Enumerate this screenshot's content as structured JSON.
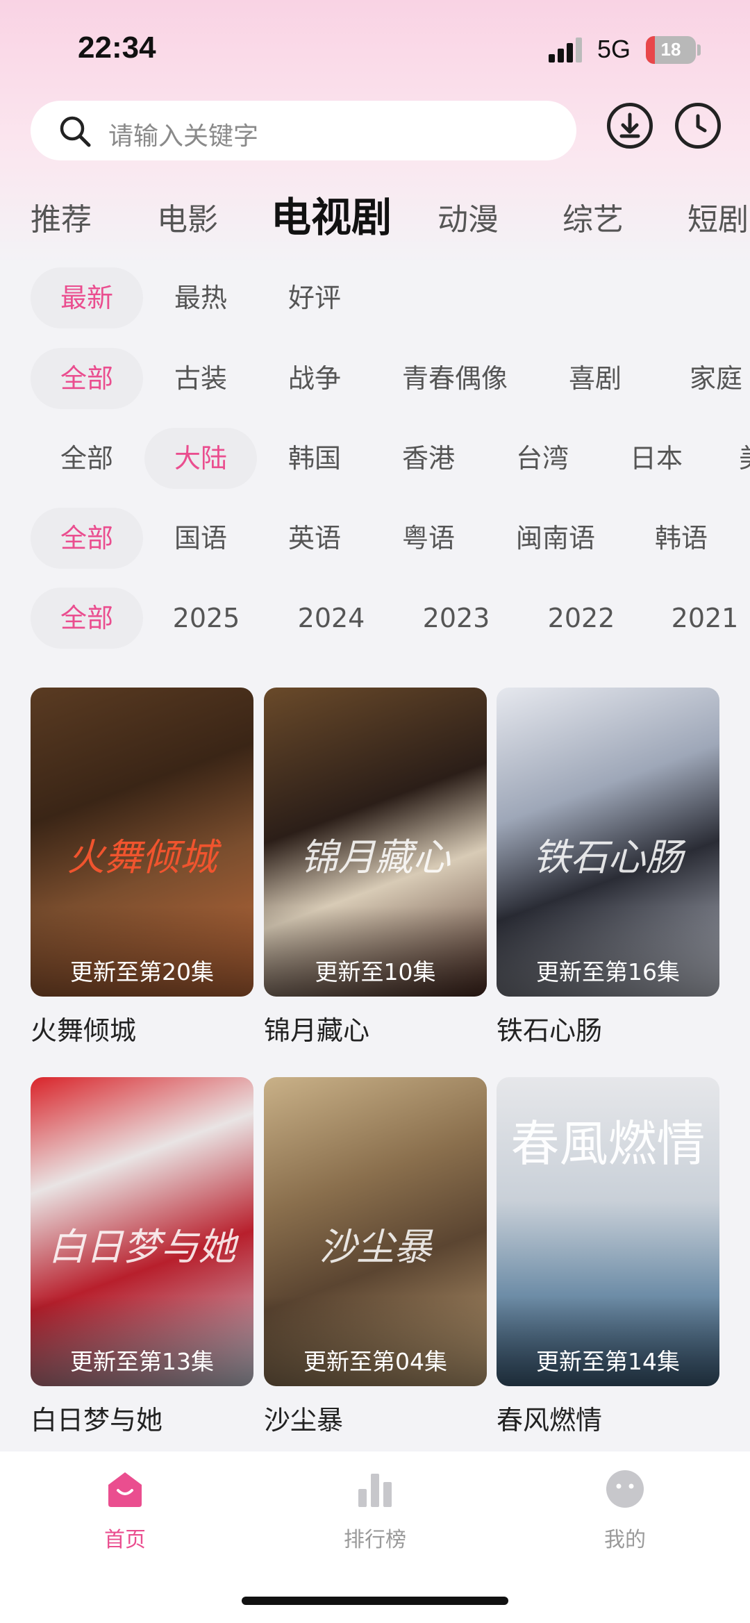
{
  "status_bar": {
    "time": "22:34",
    "network": "5G",
    "battery": "18",
    "battery_fraction": 0.18,
    "battery_color": "#e8474a"
  },
  "search": {
    "placeholder": "请输入关键字",
    "icon": "search-icon",
    "download_icon": "download-icon",
    "history_icon": "clock-icon"
  },
  "main_tabs": [
    {
      "label": "推荐"
    },
    {
      "label": "电影"
    },
    {
      "label": "电视剧",
      "active": true
    },
    {
      "label": "动漫"
    },
    {
      "label": "综艺"
    },
    {
      "label": "短剧"
    }
  ],
  "filters": {
    "sort": [
      "最新",
      "最热",
      "好评"
    ],
    "genre": [
      "全部",
      "古装",
      "战争",
      "青春偶像",
      "喜剧",
      "家庭"
    ],
    "region": [
      "全部",
      "大陆",
      "韩国",
      "香港",
      "台湾",
      "日本",
      "美"
    ],
    "language": [
      "全部",
      "国语",
      "英语",
      "粤语",
      "闽南语",
      "韩语"
    ],
    "year": [
      "全部",
      "2025",
      "2024",
      "2023",
      "2022",
      "2021"
    ],
    "selected": {
      "sort": "最新",
      "genre": "全部",
      "region": "大陆",
      "language": "全部",
      "year": "全部"
    }
  },
  "posters": [
    {
      "title": "火舞倾城",
      "badge": "更新至第20集",
      "art_text": "火舞倾城"
    },
    {
      "title": "锦月藏心",
      "badge": "更新至10集",
      "art_text": "锦月藏心"
    },
    {
      "title": "铁石心肠",
      "badge": "更新至第16集",
      "art_text": "铁石心肠"
    },
    {
      "title": "白日梦与她",
      "badge": "更新至第13集",
      "art_text": "白日梦与她"
    },
    {
      "title": "沙尘暴",
      "badge": "更新至第04集",
      "art_text": "沙尘暴"
    },
    {
      "title": "春风燃情",
      "badge": "更新至第14集",
      "art_text": "春風燃情"
    }
  ],
  "tab_bar": {
    "items": [
      {
        "label": "首页",
        "icon": "home-icon",
        "active": true
      },
      {
        "label": "排行榜",
        "icon": "bar-chart-icon"
      },
      {
        "label": "我的",
        "icon": "profile-face-icon"
      }
    ],
    "accent": "#ea4e8f",
    "inactive": "#9a9a9a"
  }
}
